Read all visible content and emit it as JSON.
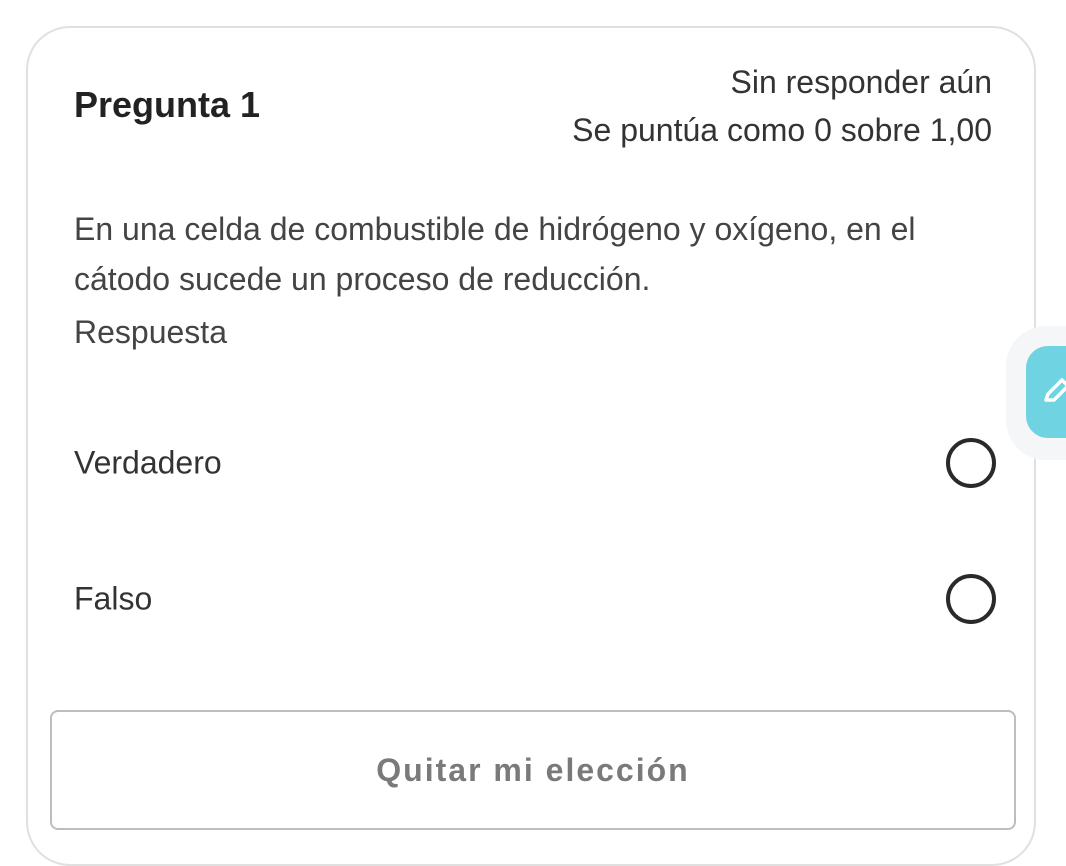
{
  "question": {
    "title": "Pregunta 1",
    "status": "Sin responder aún",
    "grade": "Se puntúa como 0 sobre 1,00",
    "text": "En una celda de combustible de hidrógeno y oxígeno, en el cátodo sucede un proceso de reducción.",
    "answer_label": "Respuesta",
    "options": [
      {
        "label": "Verdadero",
        "selected": false
      },
      {
        "label": "Falso",
        "selected": false
      }
    ],
    "clear_label": "Quitar mi elección"
  },
  "side_tab": {
    "icon": "pencil-icon",
    "color": "#6fd3e2"
  }
}
